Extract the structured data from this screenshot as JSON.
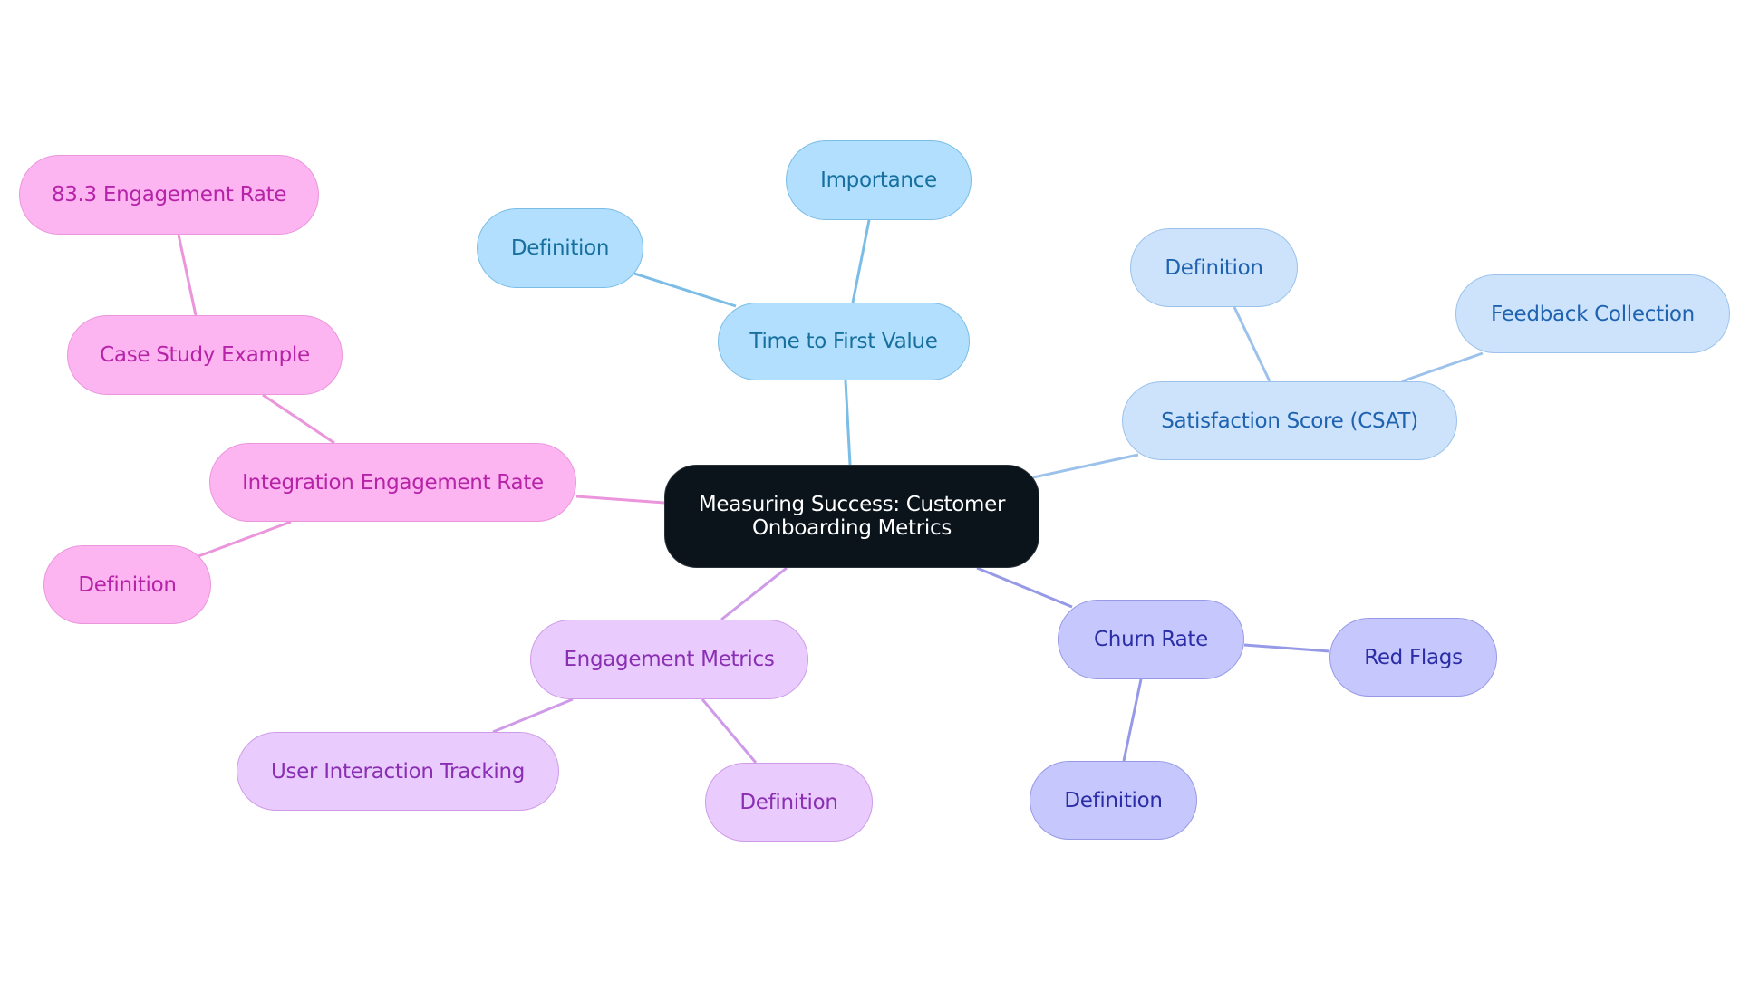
{
  "title": "Measuring Success: Customer Onboarding Metrics",
  "colors": {
    "root_bg": "#0b141b",
    "time_to_first_value": "#b2dffd",
    "csat": "#cce3fb",
    "churn": "#c6c8fd",
    "engagement": "#e9ccfd",
    "integration": "#fdb5f1"
  },
  "root": {
    "label": "Measuring Success: Customer Onboarding Metrics"
  },
  "branches": {
    "ttfv": {
      "label": "Time to First Value",
      "children": [
        "Importance",
        "Definition"
      ]
    },
    "csat": {
      "label": "Satisfaction Score (CSAT)",
      "children": [
        "Definition",
        "Feedback Collection"
      ]
    },
    "churn": {
      "label": "Churn Rate",
      "children": [
        "Red Flags",
        "Definition"
      ]
    },
    "engagement": {
      "label": "Engagement Metrics",
      "children": [
        "User Interaction Tracking",
        "Definition"
      ]
    },
    "integration": {
      "label": "Integration Engagement Rate",
      "children": [
        "Case Study Example",
        "Definition"
      ],
      "grandchildren": [
        "83.3 Engagement Rate"
      ]
    }
  }
}
